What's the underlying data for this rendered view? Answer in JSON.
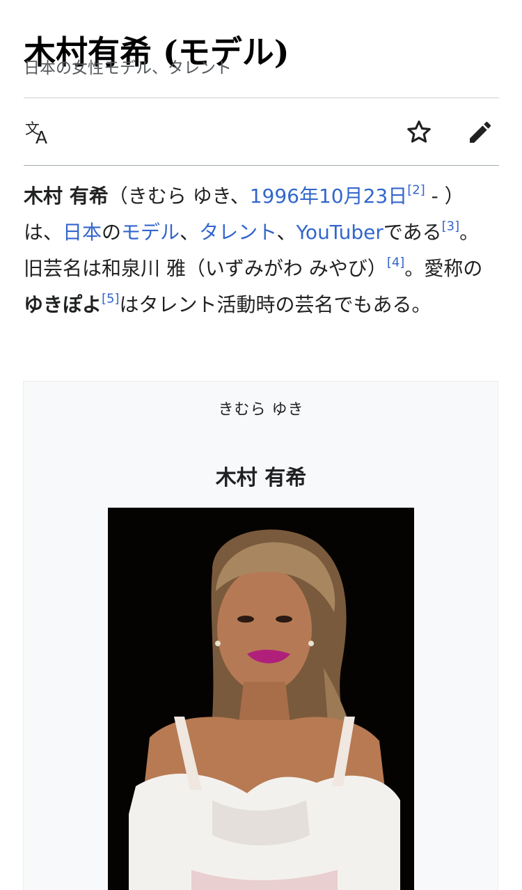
{
  "article": {
    "title": "木村有希 (モデル)",
    "description": "日本の女性モデル、タレント"
  },
  "toolbar": {
    "language_icon": "translate-icon",
    "watch_icon": "star-icon",
    "edit_icon": "pencil-icon"
  },
  "lead": {
    "name_bold": "木村 有希",
    "t1": "（きむら ゆき、",
    "birth_date_link": "1996年10月23日",
    "ref2": "[2]",
    "t2": " - ）は、",
    "link_japan": "日本",
    "t3": "の",
    "link_model": "モデル",
    "t4": "、",
    "link_talent": "タレント",
    "t5": "、",
    "link_youtuber": "YouTuber",
    "t6": "である",
    "ref3": "[3]",
    "t7": "。旧芸名は和泉川 雅（いずみがわ みやび）",
    "ref4": "[4]",
    "t8": "。愛称の",
    "nickname_bold": "ゆきぽよ",
    "ref5": "[5]",
    "t9": "はタレント活動時の芸名でもある。"
  },
  "infobox": {
    "kana": "きむら ゆき",
    "name": "木村 有希"
  },
  "colors": {
    "link": "#3366cc",
    "text": "#202122",
    "muted": "#54595d",
    "infobox_bg": "#f8f9fa",
    "icon": "#202122"
  }
}
